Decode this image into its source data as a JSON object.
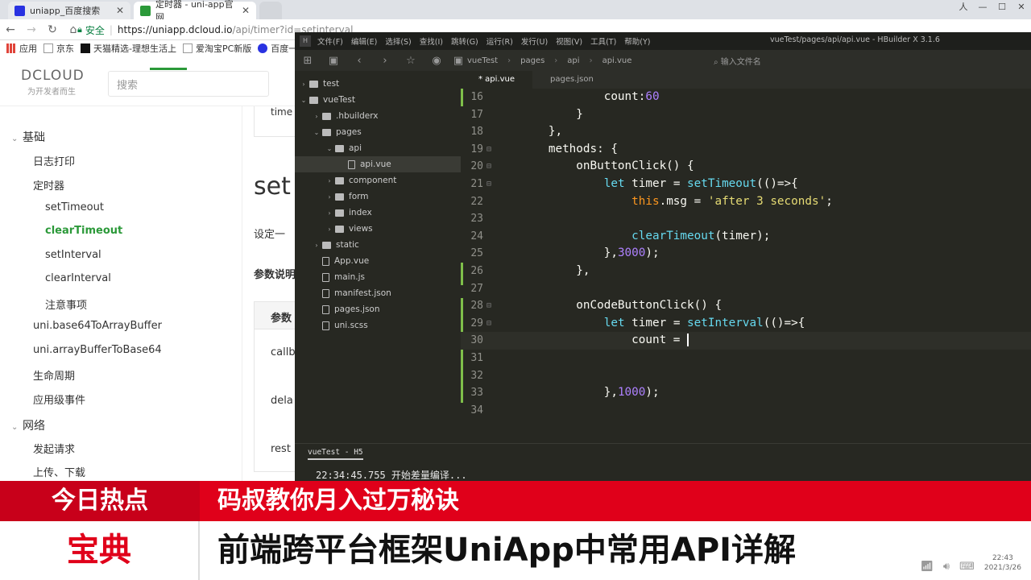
{
  "browser": {
    "tabs": [
      {
        "title": "uniapp_百度搜索",
        "favicon_color": "#2932e1"
      },
      {
        "title": "定时器 - uni-app官网",
        "favicon_color": "#2b9939"
      }
    ],
    "window_controls": [
      "人",
      "—",
      "☐",
      "✕"
    ],
    "address": {
      "secure_label": "安全",
      "host": "https://uniapp.dcloud.io",
      "path": "/api/timer?id=setinterval"
    },
    "bookmarks": [
      {
        "label": "应用",
        "icon": "apps-icon"
      },
      {
        "label": "京东",
        "icon": "page-icon"
      },
      {
        "label": "天猫精选-理想生活上",
        "icon": "tmall-icon"
      },
      {
        "label": "爱淘宝PC新版",
        "icon": "page-icon"
      },
      {
        "label": "百度一",
        "icon": "baidu-icon"
      }
    ]
  },
  "site": {
    "logo": "DCLOUD",
    "logo_sub": "为开发者而生",
    "search_placeholder": "搜索",
    "sidebar": [
      {
        "label": "基础",
        "level": 0,
        "group": true
      },
      {
        "label": "日志打印",
        "level": 1
      },
      {
        "label": "定时器",
        "level": 1
      },
      {
        "label": "setTimeout",
        "level": 2
      },
      {
        "label": "clearTimeout",
        "level": 2,
        "active": true
      },
      {
        "label": "setInterval",
        "level": 2
      },
      {
        "label": "clearInterval",
        "level": 2
      },
      {
        "label": "注意事项",
        "level": 2
      },
      {
        "label": "uni.base64ToArrayBuffer",
        "level": 1
      },
      {
        "label": "uni.arrayBufferToBase64",
        "level": 1
      },
      {
        "label": "生命周期",
        "level": 1
      },
      {
        "label": "应用级事件",
        "level": 1
      },
      {
        "label": "网络",
        "level": 0,
        "group": true
      },
      {
        "label": "发起请求",
        "level": 1
      },
      {
        "label": "上传、下载",
        "level": 1
      }
    ],
    "content": {
      "box_text": "time",
      "heading": "set",
      "desc": "设定一",
      "params_title": "参数说明",
      "table_header": "参数",
      "rows": [
        "callb",
        "dela",
        "rest"
      ]
    }
  },
  "hbuilder": {
    "menu": [
      "文件(F)",
      "编辑(E)",
      "选择(S)",
      "查找(I)",
      "跳转(G)",
      "运行(R)",
      "发行(U)",
      "视图(V)",
      "工具(T)",
      "帮助(Y)"
    ],
    "title": "vueTest/pages/api/api.vue - HBuilder X 3.1.6",
    "breadcrumb": [
      "vueTest",
      "pages",
      "api",
      "api.vue"
    ],
    "file_input_placeholder": "输入文件名",
    "tree": [
      {
        "label": "test",
        "depth": 0,
        "arrow": "›",
        "kind": "project"
      },
      {
        "label": "vueTest",
        "depth": 0,
        "arrow": "⌄",
        "kind": "project"
      },
      {
        "label": ".hbuilderx",
        "depth": 1,
        "arrow": "›",
        "kind": "folder"
      },
      {
        "label": "pages",
        "depth": 1,
        "arrow": "⌄",
        "kind": "folder"
      },
      {
        "label": "api",
        "depth": 2,
        "arrow": "⌄",
        "kind": "folder"
      },
      {
        "label": "api.vue",
        "depth": 3,
        "arrow": "",
        "kind": "file",
        "selected": true
      },
      {
        "label": "component",
        "depth": 2,
        "arrow": "›",
        "kind": "folder"
      },
      {
        "label": "form",
        "depth": 2,
        "arrow": "›",
        "kind": "folder"
      },
      {
        "label": "index",
        "depth": 2,
        "arrow": "›",
        "kind": "folder"
      },
      {
        "label": "views",
        "depth": 2,
        "arrow": "›",
        "kind": "folder"
      },
      {
        "label": "static",
        "depth": 1,
        "arrow": "›",
        "kind": "folder"
      },
      {
        "label": "App.vue",
        "depth": 1,
        "arrow": "",
        "kind": "file"
      },
      {
        "label": "main.js",
        "depth": 1,
        "arrow": "",
        "kind": "file"
      },
      {
        "label": "manifest.json",
        "depth": 1,
        "arrow": "",
        "kind": "file"
      },
      {
        "label": "pages.json",
        "depth": 1,
        "arrow": "",
        "kind": "file"
      },
      {
        "label": "uni.scss",
        "depth": 1,
        "arrow": "",
        "kind": "file"
      }
    ],
    "editor_tabs": [
      {
        "label": "* api.vue",
        "active": true
      },
      {
        "label": "pages.json",
        "active": false
      }
    ],
    "code": [
      {
        "n": "16",
        "fold": "",
        "html": "<span class='prop'>                count:</span><span class='num-lit'>60</span>"
      },
      {
        "n": "17",
        "fold": "",
        "html": "            }"
      },
      {
        "n": "18",
        "fold": "",
        "html": "        },"
      },
      {
        "n": "19",
        "fold": "⊟",
        "html": "        methods: {"
      },
      {
        "n": "20",
        "fold": "⊟",
        "html": "            onButtonClick() {"
      },
      {
        "n": "21",
        "fold": "⊟",
        "html": "                <span class='kw'>let</span> timer = <span class='fn'>setTimeout</span>(()=>{"
      },
      {
        "n": "22",
        "fold": "",
        "html": "                    <span class='this'>this</span>.msg = <span class='str'>'after 3 seconds'</span>;"
      },
      {
        "n": "23",
        "fold": "",
        "html": ""
      },
      {
        "n": "24",
        "fold": "",
        "html": "                    <span class='fn'>clearTimeout</span>(timer);"
      },
      {
        "n": "25",
        "fold": "",
        "html": "                },<span class='num-lit'>3000</span>);"
      },
      {
        "n": "26",
        "fold": "",
        "html": "            },"
      },
      {
        "n": "27",
        "fold": "",
        "html": ""
      },
      {
        "n": "28",
        "fold": "⊟",
        "html": "            onCodeButtonClick() {"
      },
      {
        "n": "29",
        "fold": "⊟",
        "html": "                <span class='kw'>let</span> timer = <span class='fn'>setInterval</span>(()=>{"
      },
      {
        "n": "30",
        "fold": "",
        "html": "                    count = <span class='cursor'></span>",
        "current": true
      },
      {
        "n": "31",
        "fold": "",
        "html": ""
      },
      {
        "n": "32",
        "fold": "",
        "html": ""
      },
      {
        "n": "33",
        "fold": "",
        "html": "                },<span class='num-lit'>1000</span>);"
      },
      {
        "n": "34",
        "fold": "",
        "html": ""
      }
    ],
    "console_tab": "vueTest - H5",
    "console_line": "22:34:45.755 开始差量编译..."
  },
  "banner": {
    "top_left": "今日热点",
    "top_right": "码叔教你月入过万秘诀",
    "bottom_left": "宝典",
    "bottom_right": "前端跨平台框架UniApp中常用API详解",
    "clock_time": "22:43",
    "clock_date": "2021/3/26"
  }
}
